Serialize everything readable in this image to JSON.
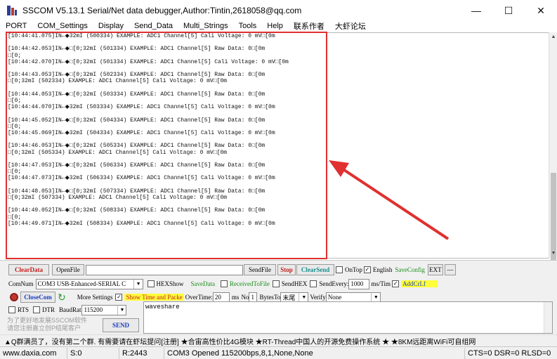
{
  "window": {
    "title": "SSCOM V5.13.1 Serial/Net data debugger,Author:Tintin,2618058@qq.com",
    "controls": {
      "minimize": "—",
      "maximize": "☐",
      "close": "✕"
    }
  },
  "menu": [
    "PORT",
    "COM_Settings",
    "Display",
    "Send_Data",
    "Multi_Strings",
    "Tools",
    "Help",
    "联系作者",
    "大虾论坛"
  ],
  "receive": {
    "lines": [
      "[10:44:41.075]IN←◆32mI (500334) EXAMPLE: ADC1 Channel[5] Cali Voltage: 0 mV□[0m",
      "",
      "[10:44:42.053]IN←◆□[0;32mI (501334) EXAMPLE: ADC1 Channel[5] Raw Data: 0□[0m",
      "□[0;",
      "[10:44:42.070]IN←◆□[0;32mI (501334) EXAMPLE: ADC1 Channel[5] Cali Voltage: 0 mV□[0m",
      "",
      "[10:44:43.053]IN←◆□[0;32mI (502334) EXAMPLE: ADC1 Channel[5] Raw Data: 0□[0m",
      "□[0;32mI (502334) EXAMPLE: ADC1 Channel[5] Cali Voltage: 0 mV□[0m",
      "",
      "[10:44:44.053]IN←◆□[0;32mI (503334) EXAMPLE: ADC1 Channel[5] Raw Data: 0□[0m",
      "□[0;",
      "[10:44:44.070]IN←◆32mI (503334) EXAMPLE: ADC1 Channel[5] Cali Voltage: 0 mV□[0m",
      "",
      "[10:44:45.052]IN←◆□[0;32mI (504334) EXAMPLE: ADC1 Channel[5] Raw Data: 0□[0m",
      "□[0;",
      "[10:44:45.069]IN←◆32mI (504334) EXAMPLE: ADC1 Channel[5] Cali Voltage: 0 mV□[0m",
      "",
      "[10:44:46.053]IN←◆□[0;32mI (505334) EXAMPLE: ADC1 Channel[5] Raw Data: 0□[0m",
      "□[0;32mI (505334) EXAMPLE: ADC1 Channel[5] Cali Voltage: 0 mV□[0m",
      "",
      "[10:44:47.053]IN←◆□[0;32mI (506334) EXAMPLE: ADC1 Channel[5] Raw Data: 0□[0m",
      "□[0;",
      "[10:44:47.073]IN←◆32mI (506334) EXAMPLE: ADC1 Channel[5] Cali Voltage: 0 mV□[0m",
      "",
      "[10:44:48.053]IN←◆□[0;32mI (507334) EXAMPLE: ADC1 Channel[5] Raw Data: 0□[0m",
      "□[0;32mI (507334) EXAMPLE: ADC1 Channel[5] Cali Voltage: 0 mV□[0m",
      "",
      "[10:44:49.052]IN←◆□[0;32mI (508334) EXAMPLE: ADC1 Channel[5] Raw Data: 0□[0m",
      "□[0;",
      "[10:44:49.071]IN←◆32mI (508334) EXAMPLE: ADC1 Channel[5] Cali Voltage: 0 mV□[0m"
    ]
  },
  "toolbar1": {
    "clear_data": "ClearData",
    "open_file": "OpenFile",
    "send_file": "SendFile",
    "stop": "Stop",
    "clear_send": "ClearSend",
    "ontop": "OnTop",
    "english": "English",
    "save_config": "SaveConfig",
    "ext": "EXT",
    "dash": "—"
  },
  "toolbar2": {
    "com_num_label": "ComNum",
    "com_port": "COM3 USB-Enhanced-SERIAL C",
    "hex_show": "HEXShow",
    "save_data": "SaveData",
    "received_to_file": "ReceivedToFile",
    "send_hex": "SendHEX",
    "send_every": "SendEvery:",
    "interval": "1000",
    "interval_unit": "ms/Tim",
    "add_crlf": "AddCrLf"
  },
  "toolbar3": {
    "close_com": "CloseCom",
    "more_settings": "More Settings",
    "show_time_and_packet": "Show Time and Packe",
    "overtime_label": "OverTime:",
    "overtime": "20",
    "ms": "ms",
    "no_label": "No",
    "no_value": "1",
    "bytes_to": "BytesTo",
    "bytes_to_value": "末尾",
    "verify": "Verify",
    "verify_value": "None"
  },
  "toolbar4": {
    "rts": "RTS",
    "dtr": "DTR",
    "baudrate_label": "BaudRat",
    "baudrate": "115200"
  },
  "send_area": {
    "text": "waveshare",
    "promo_left_1": "为了更好地发展SSCOM软件",
    "promo_left_2": "请您注册嘉立创P结尾客户",
    "send_button": "SEND"
  },
  "promo_bar": "▲Q群满员了，没有第二个群. 有需要请在虾坛提问[注册] ★合宙高性价比4G模块 ★RT-Thread中国人的开源免费操作系统 ★ ★8KM远距离WiFi可自组网",
  "status": {
    "website": "www.daxia.com",
    "s": "S:0",
    "r": "R:2443",
    "port_status": "COM3 Opened  115200bps,8,1,None,None",
    "signals": "CTS=0 DSR=0 RLSD=0"
  },
  "colors": {
    "highlight_box": "#e03030",
    "add_crlf_bg": "#ffff3a"
  }
}
